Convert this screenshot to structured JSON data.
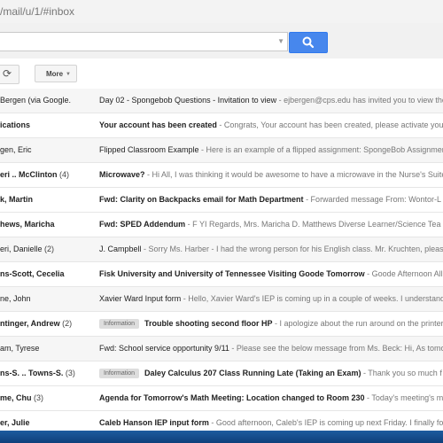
{
  "browser": {
    "url": "/mail/u/1/#inbox"
  },
  "toolbar": {
    "more_label": "More"
  },
  "icons": {
    "search": "search-icon",
    "refresh": "refresh-icon",
    "more_caret": "chevron-down-icon"
  },
  "colors": {
    "search_button": "#4787ed",
    "label_bg": "#dddddd",
    "read_row_bg": "#f6f6f6"
  },
  "emails": [
    {
      "sender": "Bergen (via Google.",
      "count": "",
      "label": "",
      "subject": "Day 02 - Spongebob Questions - Invitation to view",
      "snippet": " - ejbergen@cps.edu has invited you to view the",
      "unread": false
    },
    {
      "sender": "ications",
      "count": "",
      "label": "",
      "subject": "Your account has been created",
      "snippet": " - Congrats, Your account has been created, please activate your",
      "unread": true
    },
    {
      "sender": "gen, Eric",
      "count": "",
      "label": "",
      "subject": "Flipped Classroom Example",
      "snippet": " - Here is an example of a flipped assignment: SpongeBob Assignment",
      "unread": false
    },
    {
      "sender": "eri .. McClinton",
      "count": " (4)",
      "label": "",
      "subject": "Microwave?",
      "snippet": " - Hi All, I was thinking it would be awesome to have a microwave in the Nurse's Suite",
      "unread": true
    },
    {
      "sender": "k, Martin",
      "count": "",
      "label": "",
      "subject": "Fwd: Clarity on Backpacks email for Math Department",
      "snippet": " - Forwarded message From: Wontor-L",
      "unread": true
    },
    {
      "sender": "hews, Maricha",
      "count": "",
      "label": "",
      "subject": "Fwd: SPED Addendum",
      "snippet": " - F YI  Regards, Mrs. Maricha D. Matthews Diverse Learner/Science Tea",
      "unread": true
    },
    {
      "sender": "eri, Danielle",
      "count": " (2)",
      "label": "",
      "subject": "J. Campbell",
      "snippet": " - Sorry Ms. Harber - I had the wrong person for his English class. Mr. Kruchten, please",
      "unread": false
    },
    {
      "sender": "ns-Scott, Cecelia",
      "count": "",
      "label": "",
      "subject": "Fisk University and University of Tennessee Visiting Goode Tomorrow",
      "snippet": " - Goode Afternoon All",
      "unread": true
    },
    {
      "sender": "ne, John",
      "count": "",
      "label": "",
      "subject": "Xavier Ward Input form",
      "snippet": " - Hello, Xavier Ward's IEP is coming up in a couple of weeks. I understand",
      "unread": false
    },
    {
      "sender": "ntinger, Andrew",
      "count": " (2)",
      "label": "Information",
      "subject": "Trouble shooting second floor HP",
      "snippet": " - I apologize about the run around on the printer",
      "unread": true
    },
    {
      "sender": "am, Tyrese",
      "count": "",
      "label": "",
      "subject": "Fwd: School service opportunity 9/11",
      "snippet": " - Please see the below message from Ms. Beck: Hi, As tomo",
      "unread": false
    },
    {
      "sender": "ns-S. .. Towns-S.",
      "count": " (3)",
      "label": "Information",
      "subject": "Daley Calculus 207 Class Running Late (Taking an Exam)",
      "snippet": " - Thank you so much f",
      "unread": true
    },
    {
      "sender": "me, Chu",
      "count": " (3)",
      "label": "",
      "subject": "Agenda for Tomorrow's Math Meeting: Location changed to Room 230",
      "snippet": " - Today's meeting's m",
      "unread": true
    },
    {
      "sender": "er, Julie",
      "count": "",
      "label": "",
      "subject": "Caleb Hanson IEP input form",
      "snippet": " - Good afternoon, Caleb's IEP is coming up next Friday. I finally fo",
      "unread": true
    }
  ]
}
